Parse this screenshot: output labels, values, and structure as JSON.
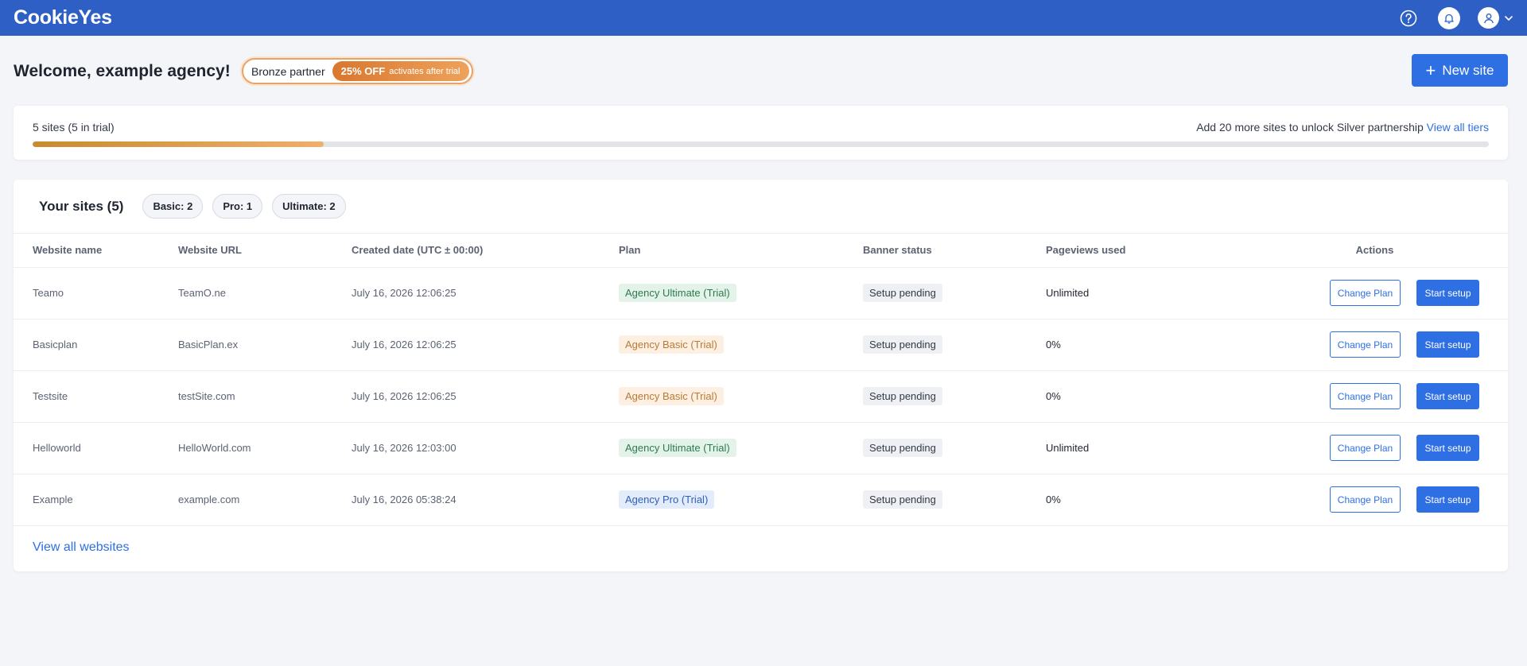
{
  "app": {
    "logo": "CookieYes"
  },
  "header": {
    "icons": [
      "help-icon",
      "bell-icon",
      "user-icon",
      "chevron-down-icon"
    ]
  },
  "welcome": {
    "title": "Welcome, example agency!",
    "partner": "Bronze partner",
    "discount_bold": "25% OFF",
    "discount_note": "activates after trial",
    "new_site_label": "New site"
  },
  "progress": {
    "left": "5 sites (5 in trial)",
    "right_text": "Add 20 more sites to unlock Silver partnership",
    "right_link": "View all tiers",
    "fraction": 0.2
  },
  "sites": {
    "title": "Your sites (5)",
    "chips": [
      "Basic: 2",
      "Pro: 1",
      "Ultimate: 2"
    ],
    "columns": [
      "Website name",
      "Website URL",
      "Created date (UTC ± 00:00)",
      "Plan",
      "Banner status",
      "Pageviews used",
      "Actions"
    ],
    "rows": [
      {
        "name": "Teamo",
        "url": "TeamO.ne",
        "date": "July 16, 2026 12:06:25",
        "plan": "Agency Ultimate (Trial)",
        "plan_type": "ultimate",
        "status": "Setup pending",
        "pageviews": "Unlimited"
      },
      {
        "name": "Basicplan",
        "url": "BasicPlan.ex",
        "date": "July 16, 2026 12:06:25",
        "plan": "Agency Basic (Trial)",
        "plan_type": "basic",
        "status": "Setup pending",
        "pageviews": "0%"
      },
      {
        "name": "Testsite",
        "url": "testSite.com",
        "date": "July 16, 2026 12:06:25",
        "plan": "Agency Basic (Trial)",
        "plan_type": "basic",
        "status": "Setup pending",
        "pageviews": "0%"
      },
      {
        "name": "Helloworld",
        "url": "HelloWorld.com",
        "date": "July 16, 2026 12:03:00",
        "plan": "Agency Ultimate (Trial)",
        "plan_type": "ultimate",
        "status": "Setup pending",
        "pageviews": "Unlimited"
      },
      {
        "name": "Example",
        "url": "example.com",
        "date": "July 16, 2026 05:38:24",
        "plan": "Agency Pro (Trial)",
        "plan_type": "pro",
        "status": "Setup pending",
        "pageviews": "0%"
      }
    ],
    "change_plan_label": "Change Plan",
    "start_setup_label": "Start setup",
    "view_all": "View all websites"
  },
  "colors": {
    "header": "#2d5fc4",
    "accent": "#2f6fe4",
    "bronze": "#d9772e"
  }
}
